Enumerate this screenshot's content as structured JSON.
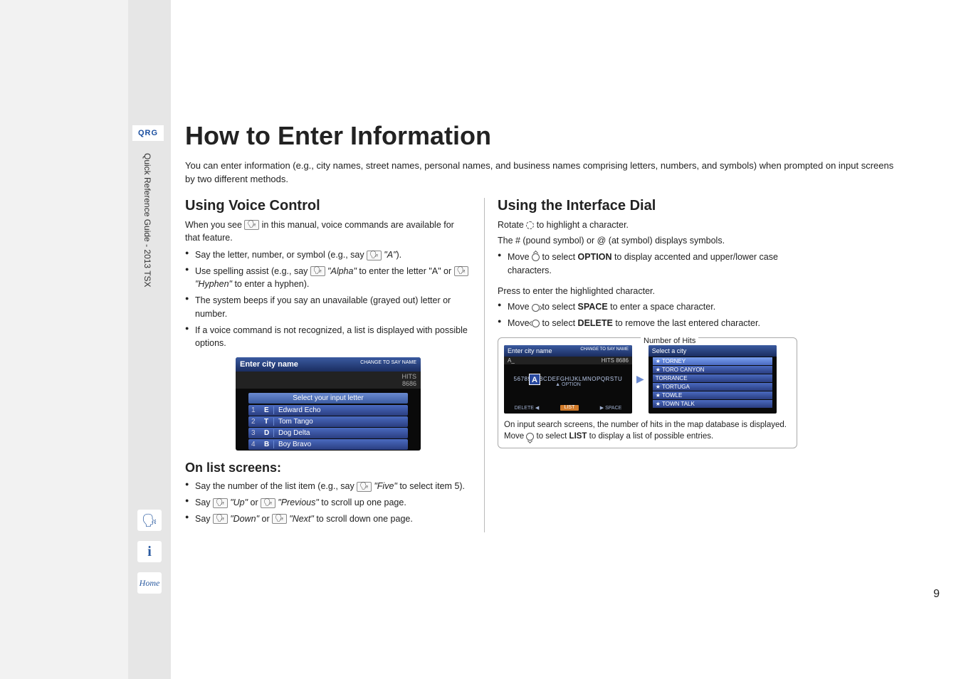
{
  "badge": "QRG",
  "spine": "Quick Reference Guide - 2013 TSX",
  "title": "How to Enter Information",
  "intro": "You can enter information (e.g., city names, street names, personal names, and business names comprising letters, numbers, and symbols) when prompted on input screens by two different methods.",
  "left": {
    "h2": "Using Voice Control",
    "lead_a": "When you see ",
    "lead_b": " in this manual, voice commands are available for that feature.",
    "b1_a": "Say the letter, number, or symbol (e.g., say ",
    "b1_b": " \"A\"",
    "b1_c": ").",
    "b2_a": "Use spelling assist (e.g., say ",
    "b2_b": " \"Alpha\"",
    "b2_c": " to enter the letter \"A\" or ",
    "b2_d": " \"Hyphen\"",
    "b2_e": " to enter a hyphen).",
    "b3": "The system beeps if you say an unavailable (grayed out) letter or number.",
    "b4": "If a voice command is not recognized, a list is displayed with possible options.",
    "shot": {
      "title": "Enter city name",
      "corner": "CHANGE TO SAY NAME",
      "hits_lbl": "HITS",
      "hits_val": "8686",
      "hint": "Select your input letter",
      "rows": [
        {
          "n": "1",
          "l": "E",
          "w": "Edward Echo"
        },
        {
          "n": "2",
          "l": "T",
          "w": "Tom Tango"
        },
        {
          "n": "3",
          "l": "D",
          "w": "Dog Delta"
        },
        {
          "n": "4",
          "l": "B",
          "w": "Boy Bravo"
        }
      ]
    },
    "h3": "On list screens:",
    "l1_a": "Say the number of the list item (e.g., say ",
    "l1_b": " \"Five\"",
    "l1_c": " to select item 5).",
    "l2_a": "Say ",
    "l2_b": " \"Up\"",
    "l2_c": " or ",
    "l2_d": " \"Previous\"",
    "l2_e": " to scroll up one page.",
    "l3_a": "Say ",
    "l3_b": " \"Down\"",
    "l3_c": " or ",
    "l3_d": " \"Next\"",
    "l3_e": " to scroll down one page."
  },
  "right": {
    "h2": "Using the Interface Dial",
    "r1_a": "Rotate ",
    "r1_b": " to highlight a character.",
    "r2": "The # (pound symbol) or @ (at symbol) displays symbols.",
    "r3_a": "Move ",
    "r3_b": " to select ",
    "r3_c": "OPTION",
    "r3_d": " to display accented and upper/lower case characters.",
    "r4": "Press to enter the highlighted character.",
    "r5_a": "Move ",
    "r5_b": " to select ",
    "r5_c": "SPACE",
    "r5_d": " to enter a space character.",
    "r6_a": "Move ",
    "r6_b": " to select ",
    "r6_c": "DELETE",
    "r6_d": " to remove the last entered character.",
    "fig": {
      "label": "Number of Hits",
      "kb_title": "Enter city name",
      "kb_corner": "CHANGE TO SAY NAME",
      "kb_entered": "A_",
      "kb_hits_lbl": "HITS",
      "kb_hits_val": "8686",
      "kb_big": "A",
      "kb_row": "567890ABCDEFGHIJKLMNOPQRSTU",
      "kb_option": "▲ OPTION",
      "kb_delete": "DELETE ◀",
      "kb_space": "▶ SPACE",
      "kb_list": "LIST",
      "list_title": "Select a city",
      "list_items": [
        "★ TORNEY",
        "★ TORO CANYON",
        "TORRANCE",
        "★ TORTUGA",
        "★ TOWLE",
        "★ TOWN TALK"
      ],
      "cap_a": "On input search screens, the number of hits in the map database is displayed. Move ",
      "cap_b": " to select ",
      "cap_c": "LIST",
      "cap_d": " to display a list of possible entries."
    }
  },
  "icons": {
    "voice": "🗣",
    "info": "i",
    "home": "Home"
  },
  "voice_glyph": "🗣",
  "page_num": "9"
}
